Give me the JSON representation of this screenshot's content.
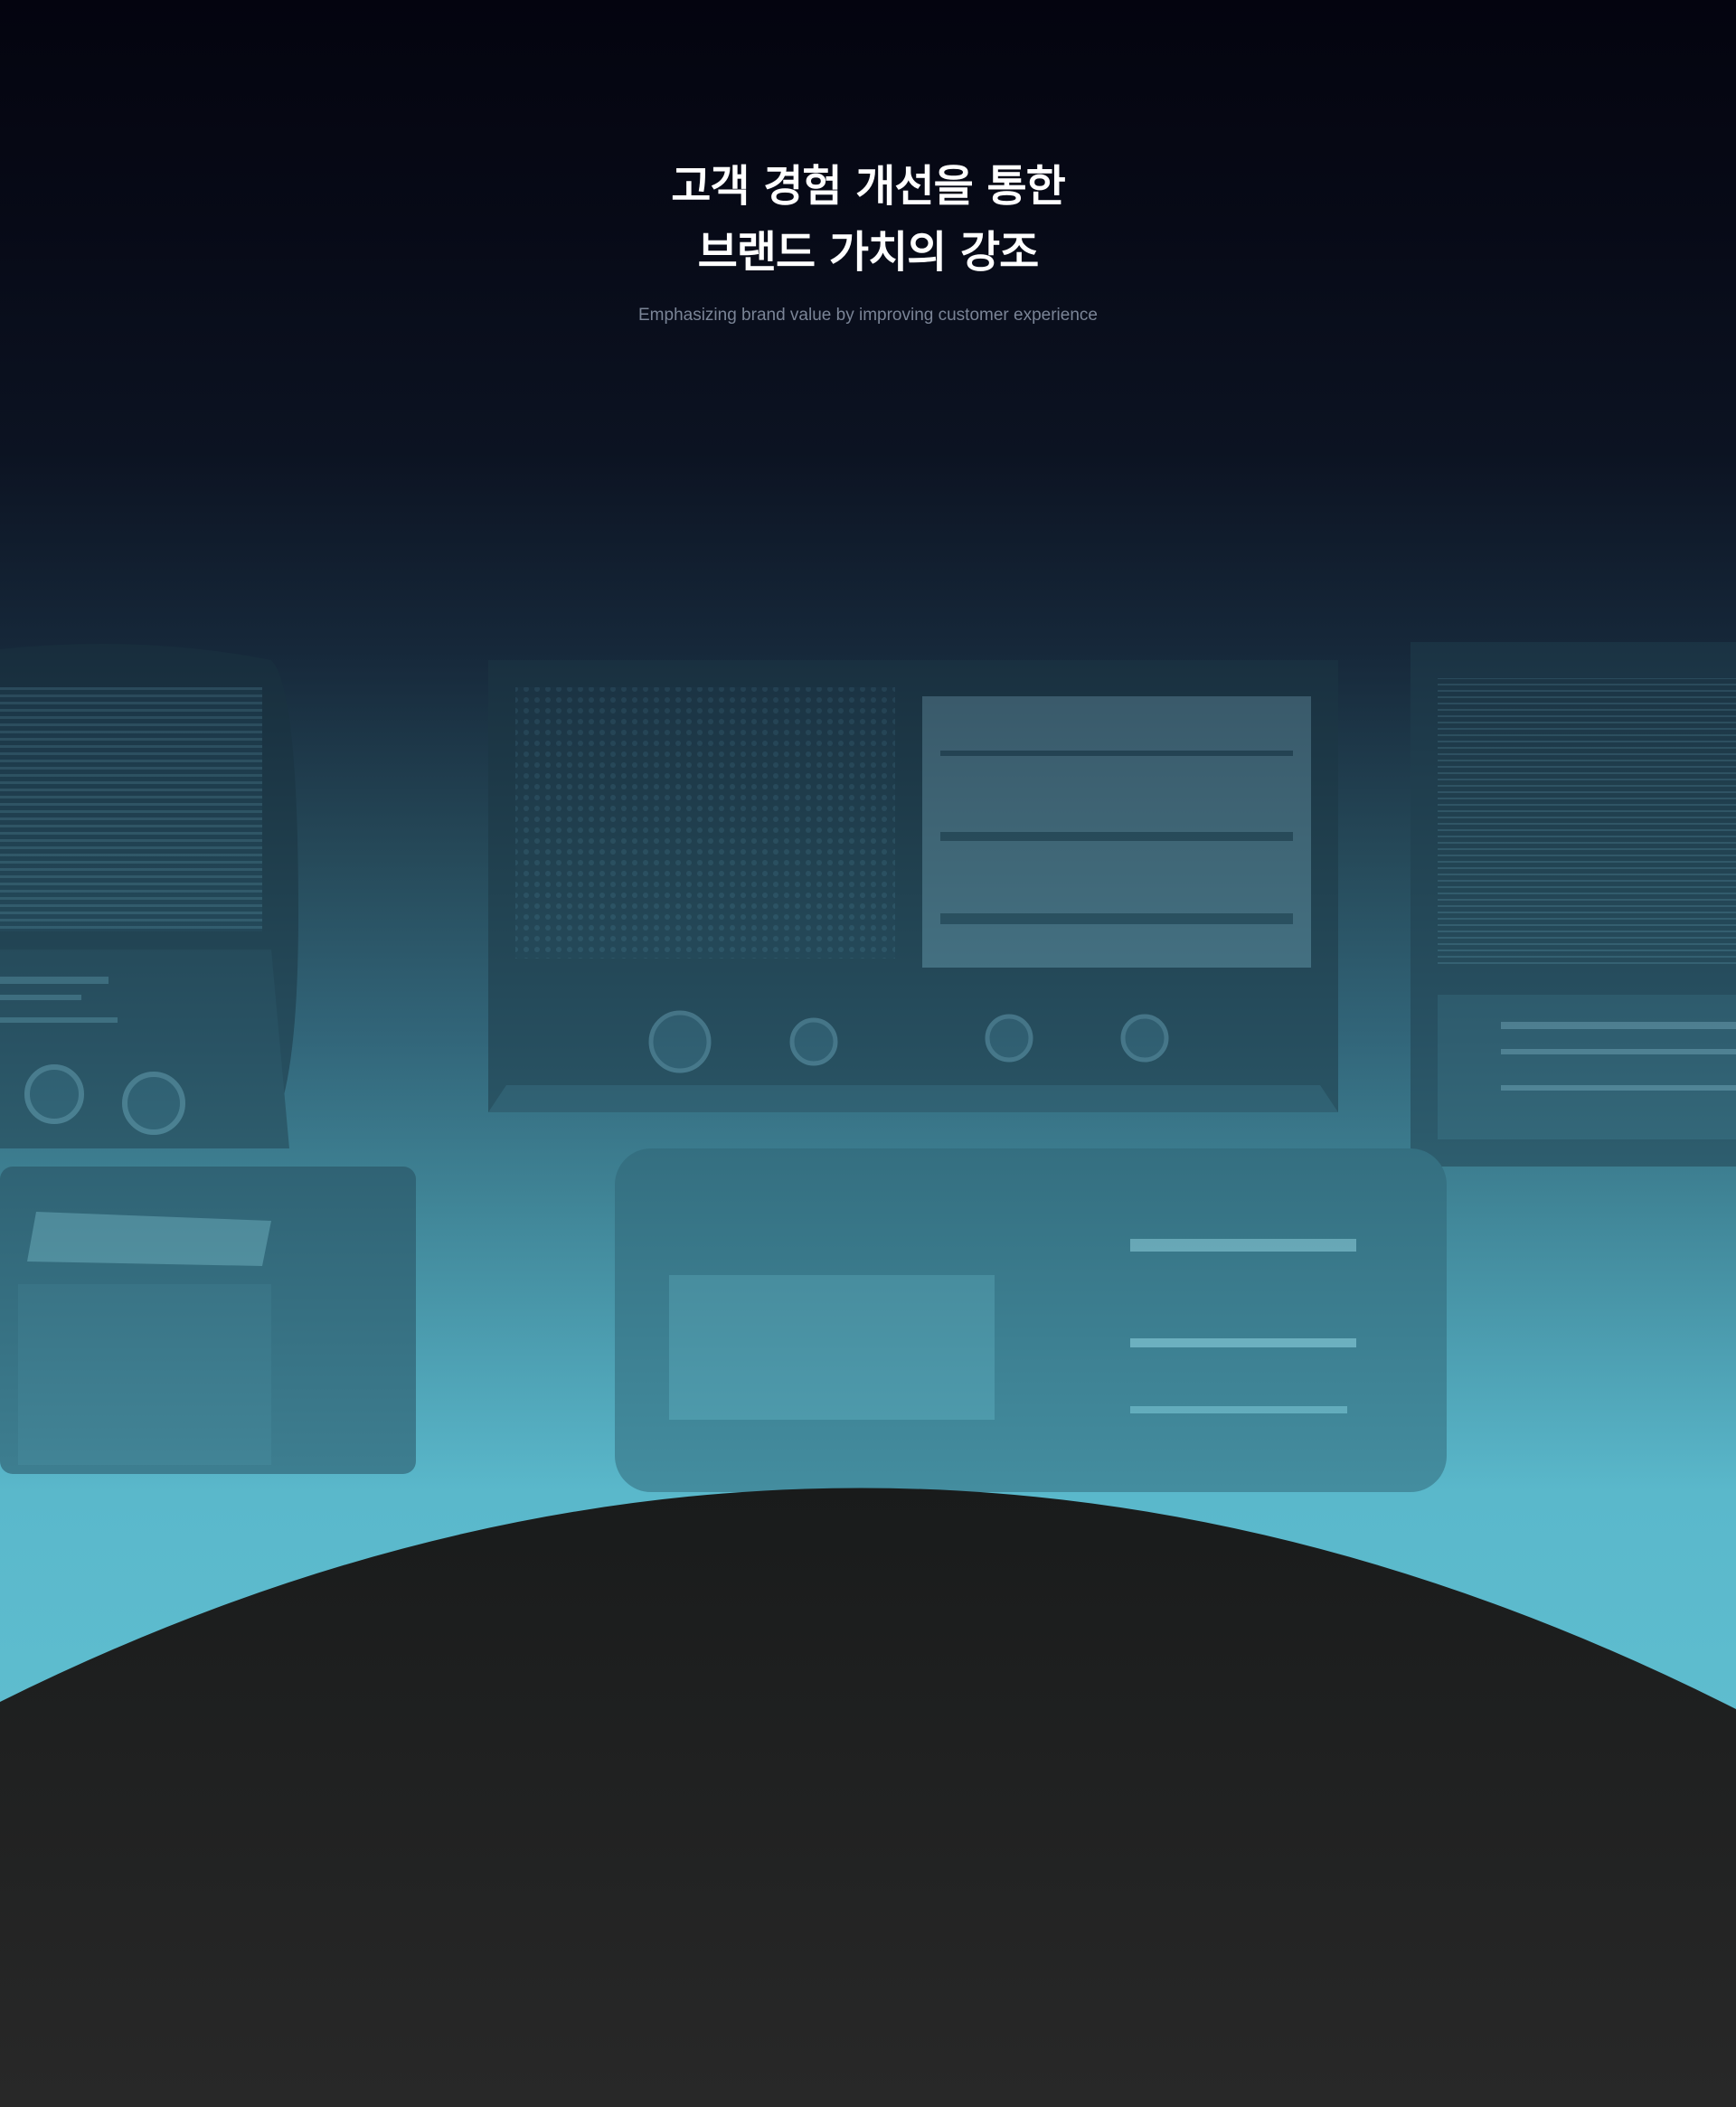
{
  "hero": {
    "title_line_1": "고객 경험 개선을 통한",
    "title_line_2": "브랜드 가치의 강조",
    "subtitle": "Emphasizing brand value by improving customer experience"
  },
  "colors": {
    "top_background": "#04040f",
    "teal_background": "#5ebdcf",
    "dome_top": "#191b1b",
    "dome_bottom": "#282828",
    "title_text": "#ffffff",
    "subtitle_text": "#7a8496"
  }
}
